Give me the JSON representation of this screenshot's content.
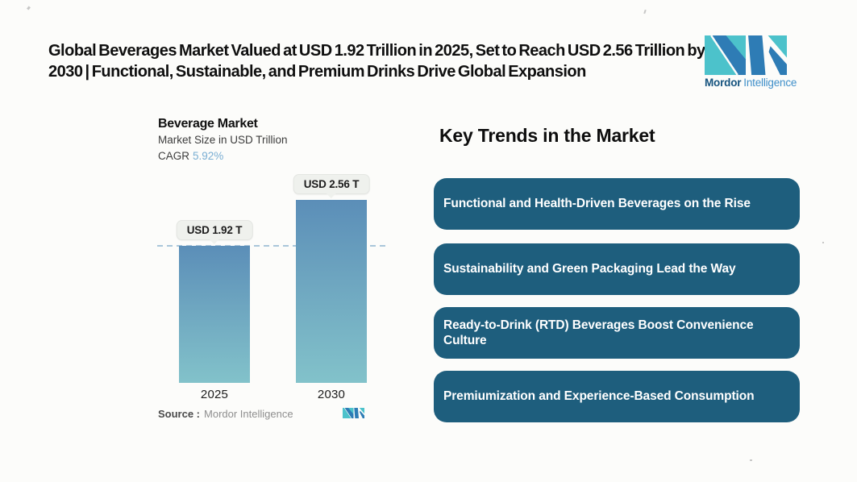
{
  "headline": "Global Beverages Market Valued at USD 1.92 Trillion in 2025, Set to Reach USD 2.56 Trillion by 2030 | Functional, Sustainable, and Premium Drinks Drive Global Expansion",
  "brand": {
    "name_bold": "Mordor",
    "name_light": "Intelligence",
    "colors": {
      "teal": "#4cc2cb",
      "blue": "#2e7cb5",
      "text_dark": "#15537e",
      "text_light": "#3f8fc9"
    }
  },
  "chart": {
    "title": "Beverage Market",
    "subtitle": "Market Size in USD Trillion",
    "cagr_label": "CAGR",
    "cagr_value": "5.92%",
    "source_label": "Source :",
    "source_value": "Mordor Intelligence"
  },
  "chart_data": {
    "type": "bar",
    "title": "Beverage Market",
    "ylabel": "Market Size in USD Trillion",
    "cagr": "5.92%",
    "categories": [
      "2025",
      "2030"
    ],
    "values": [
      1.92,
      2.56
    ],
    "value_labels": [
      "USD 1.92 T",
      "USD 2.56 T"
    ],
    "reference_line": 1.92,
    "ylim": [
      0,
      2.56
    ],
    "grid": false,
    "legend": false,
    "bar_color_top": "#5b8eb8",
    "bar_color_bottom": "#82c2ca",
    "reference_line_color": "#a9c6da"
  },
  "trends": {
    "heading": "Key Trends in the Market",
    "box_color": "#1e5e7d",
    "items": [
      "Functional and Health-Driven Beverages on the Rise",
      "Sustainability and Green Packaging Lead the Way",
      "Ready-to-Drink (RTD) Beverages Boost Convenience Culture",
      "Premiumization and Experience-Based Consumption"
    ]
  }
}
